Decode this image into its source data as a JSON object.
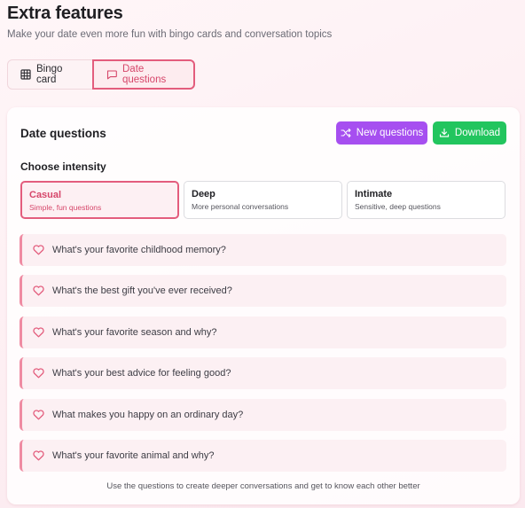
{
  "header": {
    "title": "Extra features",
    "subtitle": "Make your date even more fun with bingo cards and conversation topics"
  },
  "tabs": [
    {
      "label": "Bingo card",
      "icon": "grid-icon",
      "active": false
    },
    {
      "label": "Date questions",
      "icon": "chat-icon",
      "active": true
    }
  ],
  "panel": {
    "title": "Date questions",
    "new_questions_label": "New questions",
    "download_label": "Download",
    "intensity_label": "Choose intensity",
    "intensities": [
      {
        "name": "Casual",
        "desc": "Simple, fun questions",
        "active": true
      },
      {
        "name": "Deep",
        "desc": "More personal conversations",
        "active": false
      },
      {
        "name": "Intimate",
        "desc": "Sensitive, deep questions",
        "active": false
      }
    ],
    "questions": [
      "What's your favorite childhood memory?",
      "What's the best gift you've ever received?",
      "What's your favorite season and why?",
      "What's your best advice for feeling good?",
      "What makes you happy on an ordinary day?",
      "What's your favorite animal and why?"
    ],
    "footer": "Use the questions to create deeper conversations and get to know each other better"
  },
  "colors": {
    "accent": "#e35d7d",
    "new_button": "#a64ff0",
    "download_button": "#22c55e"
  }
}
